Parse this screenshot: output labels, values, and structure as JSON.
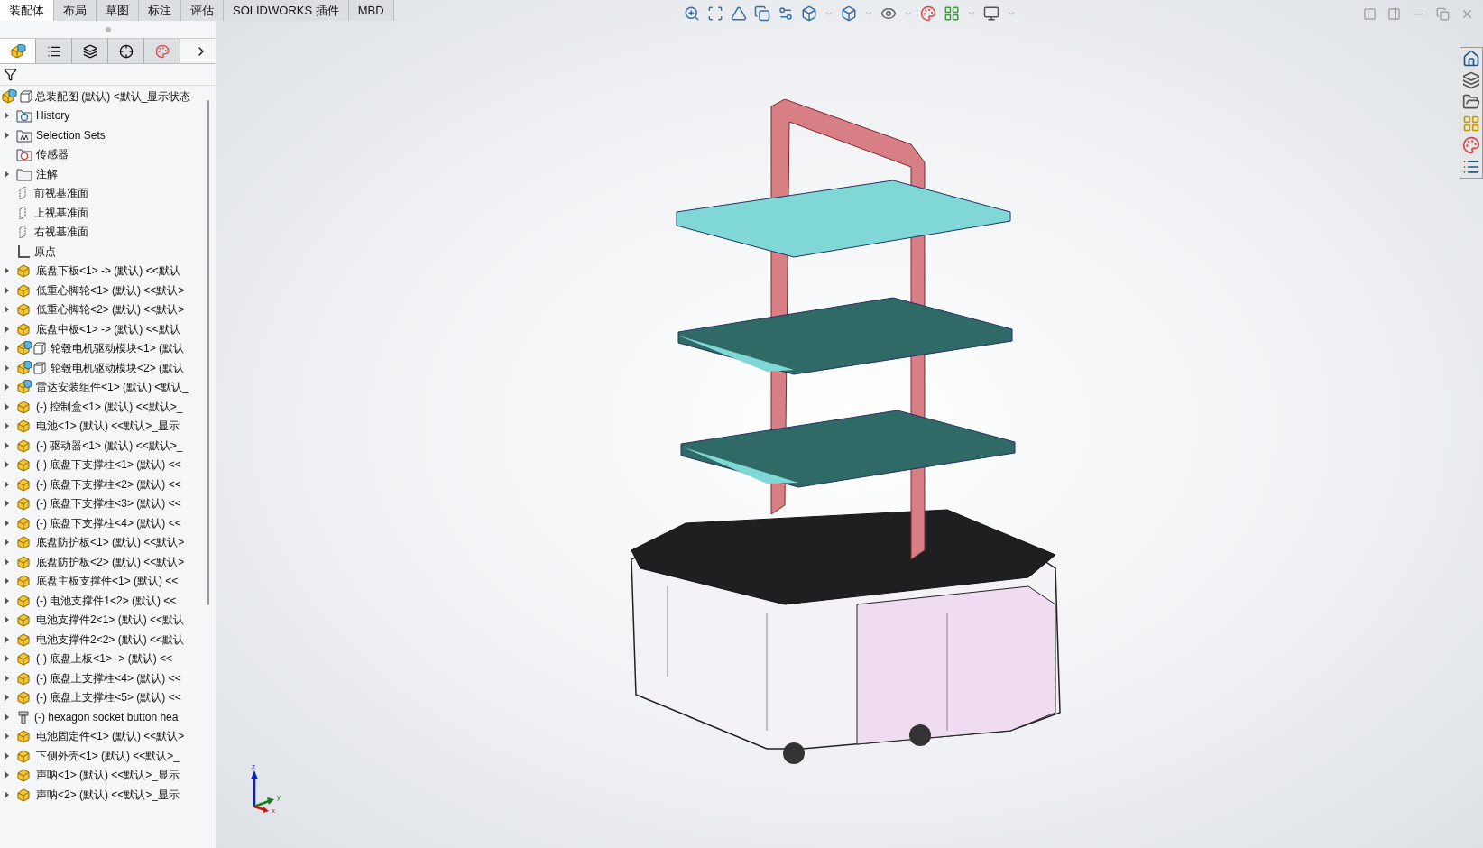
{
  "command_tabs": [
    {
      "label": "装配体",
      "selected": true
    },
    {
      "label": "布局",
      "selected": false
    },
    {
      "label": "草图",
      "selected": false
    },
    {
      "label": "标注",
      "selected": false
    },
    {
      "label": "评估",
      "selected": false
    },
    {
      "label": "SOLIDWORKS 插件",
      "selected": false
    },
    {
      "label": "MBD",
      "selected": false
    }
  ],
  "panel_tabs": [
    {
      "kind": "feature",
      "selected": true
    },
    {
      "kind": "property",
      "selected": false
    },
    {
      "kind": "config",
      "selected": false
    },
    {
      "kind": "dimxpert",
      "selected": false
    },
    {
      "kind": "display",
      "selected": false
    }
  ],
  "tree": {
    "root": {
      "label": "总装配图 (默认) <默认_显示状态-"
    },
    "items": [
      {
        "kind": "history",
        "label": "History",
        "expandable": true
      },
      {
        "kind": "selection",
        "label": "Selection Sets",
        "expandable": true
      },
      {
        "kind": "sensor",
        "label": "传感器",
        "expandable": false
      },
      {
        "kind": "annotation",
        "label": "注解",
        "expandable": true
      },
      {
        "kind": "plane",
        "label": "前视基准面",
        "expandable": false
      },
      {
        "kind": "plane",
        "label": "上视基准面",
        "expandable": false
      },
      {
        "kind": "plane",
        "label": "右视基准面",
        "expandable": false
      },
      {
        "kind": "origin",
        "label": "原点",
        "expandable": false
      },
      {
        "kind": "part",
        "label": "底盘下板<1> -> (默认) <<默认",
        "expandable": true
      },
      {
        "kind": "part",
        "label": "低重心脚轮<1> (默认) <<默认>",
        "expandable": true
      },
      {
        "kind": "part",
        "label": "低重心脚轮<2> (默认) <<默认>",
        "expandable": true
      },
      {
        "kind": "part",
        "label": "底盘中板<1> -> (默认) <<默认",
        "expandable": true
      },
      {
        "kind": "subassembly",
        "label": "轮毂电机驱动模块<1> (默认",
        "expandable": true
      },
      {
        "kind": "subassembly",
        "label": "轮毂电机驱动模块<2> (默认",
        "expandable": true
      },
      {
        "kind": "assembly",
        "label": "雷达安装组件<1> (默认) <默认_",
        "expandable": true
      },
      {
        "kind": "part",
        "label": "(-) 控制盒<1> (默认) <<默认>_",
        "expandable": true
      },
      {
        "kind": "part",
        "label": "电池<1> (默认) <<默认>_显示",
        "expandable": true
      },
      {
        "kind": "part",
        "label": "(-) 驱动器<1> (默认) <<默认>_",
        "expandable": true
      },
      {
        "kind": "part",
        "label": "(-) 底盘下支撑柱<1> (默认) <<",
        "expandable": true
      },
      {
        "kind": "part",
        "label": "(-) 底盘下支撑柱<2> (默认) <<",
        "expandable": true
      },
      {
        "kind": "part",
        "label": "(-) 底盘下支撑柱<3> (默认) <<",
        "expandable": true
      },
      {
        "kind": "part",
        "label": "(-) 底盘下支撑柱<4> (默认) <<",
        "expandable": true
      },
      {
        "kind": "part",
        "label": "底盘防护板<1> (默认) <<默认>",
        "expandable": true
      },
      {
        "kind": "part",
        "label": "底盘防护板<2> (默认) <<默认>",
        "expandable": true
      },
      {
        "kind": "part",
        "label": "底盘主板支撑件<1> (默认) <<",
        "expandable": true
      },
      {
        "kind": "part",
        "label": "(-) 电池支撑件1<2> (默认) <<",
        "expandable": true
      },
      {
        "kind": "part",
        "label": "电池支撑件2<1> (默认) <<默认",
        "expandable": true
      },
      {
        "kind": "part",
        "label": "电池支撑件2<2> (默认) <<默认",
        "expandable": true
      },
      {
        "kind": "part",
        "label": "(-) 底盘上板<1> -> (默认) <<",
        "expandable": true
      },
      {
        "kind": "part",
        "label": "(-) 底盘上支撑柱<4> (默认) <<",
        "expandable": true
      },
      {
        "kind": "part",
        "label": "(-) 底盘上支撑柱<5> (默认) <<",
        "expandable": true
      },
      {
        "kind": "fastener",
        "label": "(-) hexagon socket button hea",
        "expandable": true
      },
      {
        "kind": "part",
        "label": "电池固定件<1> (默认) <<默认>",
        "expandable": true
      },
      {
        "kind": "part",
        "label": "下侧外壳<1> (默认) <<默认>_",
        "expandable": true
      },
      {
        "kind": "part",
        "label": "声呐<1> (默认) <<默认>_显示",
        "expandable": true
      },
      {
        "kind": "part",
        "label": "声呐<2> (默认) <<默认>_显示",
        "expandable": true
      }
    ]
  },
  "triad": {
    "z": "z",
    "y": "y",
    "x": "x"
  }
}
